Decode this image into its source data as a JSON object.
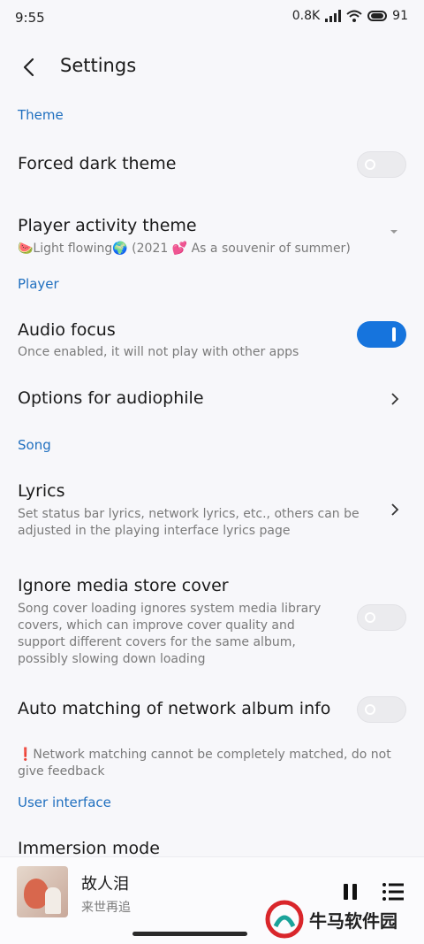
{
  "status_bar": {
    "time": "9:55",
    "speed": "0.8K",
    "battery": "91"
  },
  "header": {
    "title": "Settings"
  },
  "sections": {
    "theme": "Theme",
    "player": "Player",
    "song": "Song",
    "ui": "User interface"
  },
  "settings": {
    "forced_dark": {
      "title": "Forced dark theme",
      "enabled": false
    },
    "activity_theme": {
      "title": "Player activity theme",
      "value": "🍉Light flowing🌍 (2021 💕 As a souvenir of summer)"
    },
    "audio_focus": {
      "title": "Audio focus",
      "subtitle": "Once enabled, it will not play with other apps",
      "enabled": true
    },
    "audiophile": {
      "title": "Options for audiophile"
    },
    "lyrics": {
      "title": "Lyrics",
      "subtitle": "Set status bar lyrics, network lyrics, etc., others can be adjusted in the playing interface lyrics page"
    },
    "ignore_cover": {
      "title": "Ignore media store cover",
      "subtitle": "Song cover loading ignores system media library covers, which can improve cover quality and support different covers for the same album, possibly slowing down loading",
      "enabled": false
    },
    "auto_match": {
      "title": "Auto matching of network album info",
      "enabled": false
    },
    "network_note": "❗Network matching cannot be completely matched, do not give feedback",
    "immersion": {
      "title": "Immersion mode"
    }
  },
  "now_playing": {
    "title": "故人泪",
    "artist": "来世再追"
  },
  "watermark": {
    "text": "牛马软件园"
  },
  "colors": {
    "accent": "#1674dd",
    "section": "#1f6fbf",
    "background": "#f7f7fa"
  }
}
